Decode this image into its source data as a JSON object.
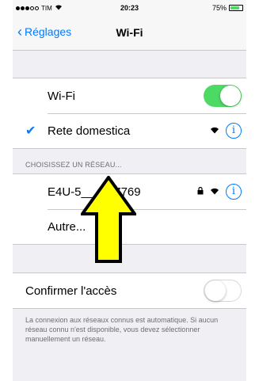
{
  "status_bar": {
    "carrier": "TIM",
    "time": "20:23",
    "battery": "75%",
    "battery_level": 0.75
  },
  "nav": {
    "back_label": "Réglages",
    "title": "Wi-Fi"
  },
  "wifi_toggle": {
    "label": "Wi-Fi",
    "on": true
  },
  "connected_network": {
    "name": "Rete domestica"
  },
  "choose_network": {
    "header": "CHOISISSEZ UN RÉSEAU...",
    "networks": [
      {
        "name": "E4U-5_____7769"
      }
    ],
    "other_label": "Autre..."
  },
  "confirm_access": {
    "label": "Confirmer l'accès",
    "on": false,
    "note": "La connexion aux réseaux connus est automatique. Si aucun réseau connu n'est disponible, vous devez sélectionner manuellement un réseau."
  },
  "colors": {
    "accent": "#007aff",
    "toggle_on": "#4cd964",
    "annotation_arrow": "#ffff00"
  },
  "icons": {
    "back": "chevron-left-icon",
    "check": "checkmark-icon",
    "wifi": "wifi-icon",
    "info": "info-icon",
    "lock": "lock-icon",
    "annotation": "up-arrow-icon"
  }
}
